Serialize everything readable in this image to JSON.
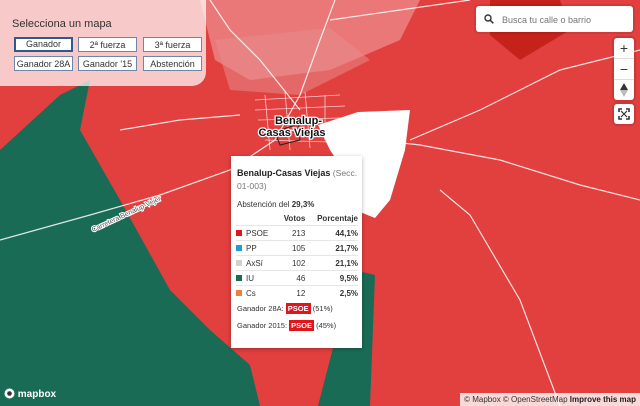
{
  "selector": {
    "title": "Selecciona un mapa",
    "buttons": [
      "Ganador",
      "2ª fuerza",
      "3ª fuerza",
      "Ganador 28A",
      "Ganador '15",
      "Abstención"
    ]
  },
  "search": {
    "placeholder": "Busca tu calle o barrio",
    "icon": "search-icon"
  },
  "controls": {
    "zoom_in": "+",
    "zoom_out": "−",
    "compass": "compass-icon",
    "fullscreen": "fullscreen-icon"
  },
  "map": {
    "place_label": "Benalup-Casas Viejas",
    "road_label": "Carretera Benalup-Vejer",
    "colors": {
      "psoe": "#e23f3f",
      "iu": "#1a6b55",
      "highlight": "#ffffff"
    }
  },
  "popup": {
    "title": "Benalup-Casas Viejas",
    "subtitle": "(Secc. 01-003)",
    "abstention_label": "Abstención del",
    "abstention_value": "29,3%",
    "headers": {
      "party": "",
      "votes": "Votos",
      "percent": "Porcentaje"
    },
    "rows": [
      {
        "party": "PSOE",
        "votes": "213",
        "percent": "44,1%",
        "color": "#e2141c"
      },
      {
        "party": "PP",
        "votes": "105",
        "percent": "21,7%",
        "color": "#1f9bd7"
      },
      {
        "party": "AxSí",
        "votes": "102",
        "percent": "21,1%",
        "color": "#d4cfcf"
      },
      {
        "party": "IU",
        "votes": "46",
        "percent": "9,5%",
        "color": "#1a6b55"
      },
      {
        "party": "Cs",
        "votes": "12",
        "percent": "2,5%",
        "color": "#ef7e3a"
      }
    ],
    "winner_28a_label": "Ganador 28A:",
    "winner_28a_party": "PSOE",
    "winner_28a_pct": "(51%)",
    "winner_2015_label": "Ganador 2015:",
    "winner_2015_party": "PSOE",
    "winner_2015_pct": "(45%)"
  },
  "footer": {
    "logo": "mapbox",
    "attr_mapbox": "© Mapbox",
    "attr_osm": "© OpenStreetMap",
    "improve": "Improve this map"
  }
}
